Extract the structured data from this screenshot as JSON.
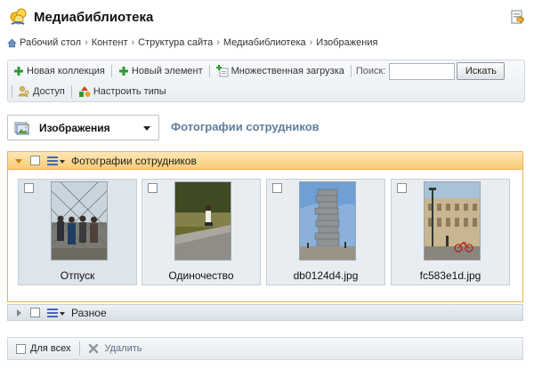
{
  "app": {
    "title": "Медиабиблиотека"
  },
  "breadcrumb": [
    "Рабочий стол",
    "Контент",
    "Структура сайта",
    "Медиабиблиотека",
    "Изображения"
  ],
  "toolbar": {
    "new_collection": "Новая коллекция",
    "new_element": "Новый элемент",
    "bulk_upload": "Множественная загрузка",
    "search_label": "Поиск:",
    "search_value": "",
    "search_button": "Искать",
    "access": "Доступ",
    "configure_types": "Настроить типы"
  },
  "section": {
    "selected": "Изображения"
  },
  "page_heading": "Фотографии сотрудников",
  "groups": [
    {
      "title": "Фотографии сотрудников",
      "expanded": true,
      "items": [
        {
          "caption": "Отпуск",
          "thumb": "fence-group-photo"
        },
        {
          "caption": "Одиночество",
          "thumb": "person-on-stone-photo"
        },
        {
          "caption": "db0124d4.jpg",
          "thumb": "book-stack-sculpture-photo"
        },
        {
          "caption": "fc583e1d.jpg",
          "thumb": "street-with-bicycle-photo"
        }
      ]
    },
    {
      "title": "Разное",
      "expanded": false
    }
  ],
  "footer": {
    "select_all": "Для всех",
    "delete": "Удалить"
  },
  "colors": {
    "accent_orange": "#f9cb74",
    "heading_blue": "#607f9b",
    "add_green": "#2e9a2e"
  }
}
